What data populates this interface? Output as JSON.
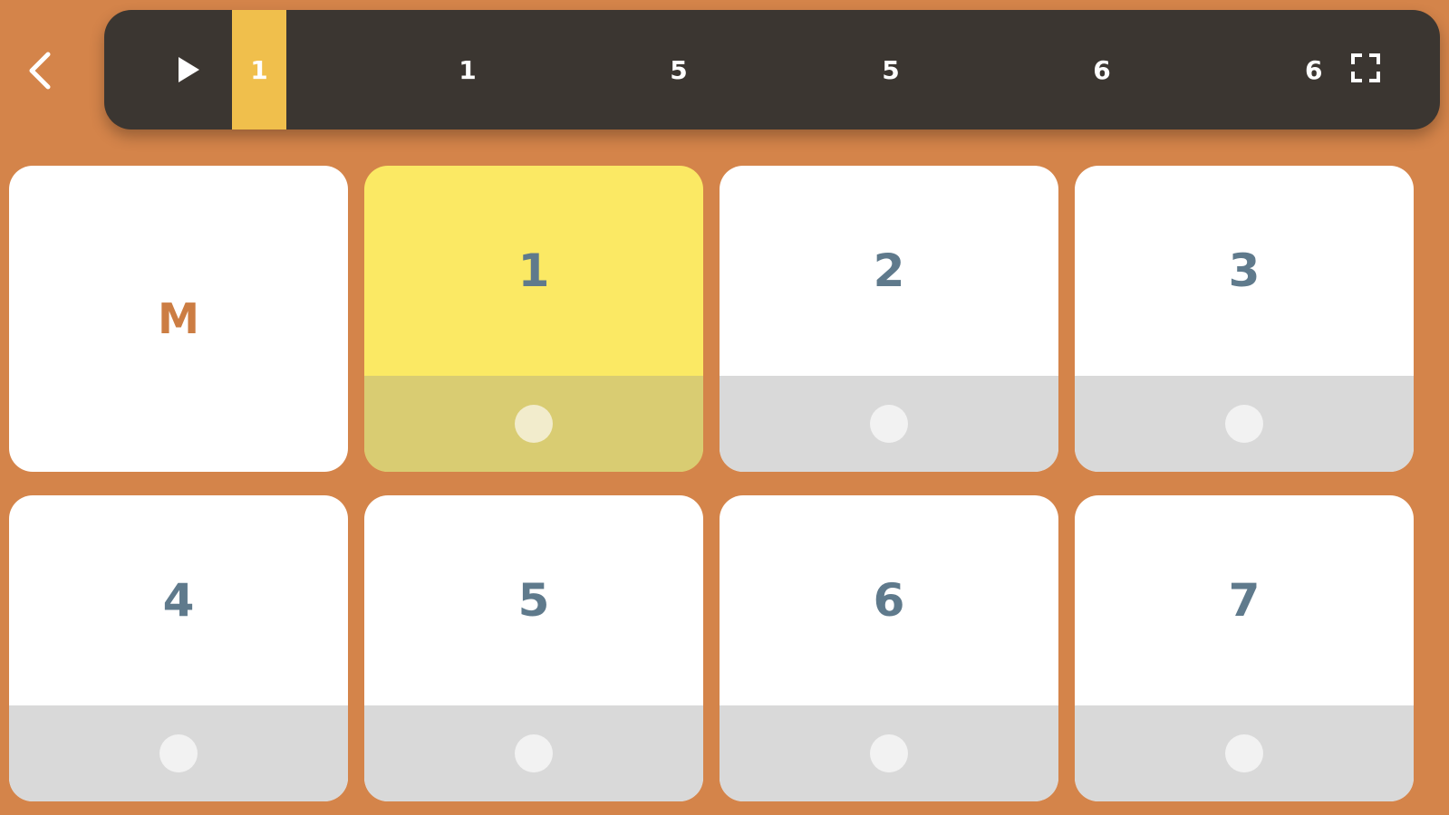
{
  "app": {
    "accent_color": "#d4844a",
    "bar_color": "#3b3631",
    "highlight_color": "#f0bf4c",
    "active_pad_color": "#fbe964"
  },
  "toolbar": {
    "back_icon": "chevron-left-icon",
    "play_icon": "play-icon",
    "fullscreen_icon": "fullscreen-icon"
  },
  "sequence": {
    "current_index": 0,
    "steps": [
      "1",
      "1",
      "5",
      "5",
      "6",
      "6"
    ]
  },
  "pads": [
    {
      "label": "M",
      "active": false,
      "has_dot": false
    },
    {
      "label": "1",
      "active": true,
      "has_dot": true
    },
    {
      "label": "2",
      "active": false,
      "has_dot": true
    },
    {
      "label": "3",
      "active": false,
      "has_dot": true
    },
    {
      "label": "4",
      "active": false,
      "has_dot": true
    },
    {
      "label": "5",
      "active": false,
      "has_dot": true
    },
    {
      "label": "6",
      "active": false,
      "has_dot": true
    },
    {
      "label": "7",
      "active": false,
      "has_dot": true
    }
  ]
}
